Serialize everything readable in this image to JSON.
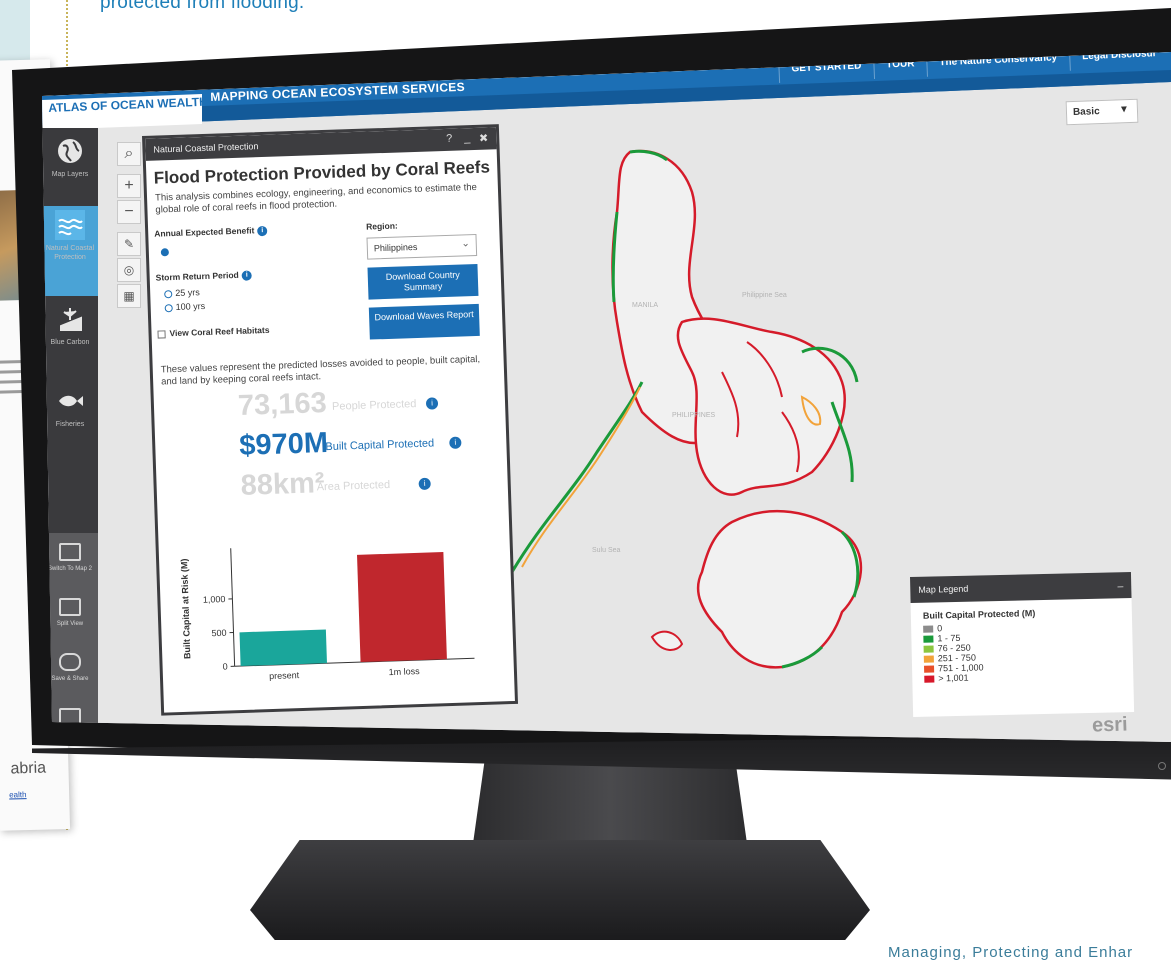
{
  "background": {
    "top_text": "protected from flooding.",
    "side_brand": "abria",
    "side_link": "ealth",
    "footer_text": "Managing, Protecting and Enhar"
  },
  "topnav": {
    "brand": "ATLAS OF OCEAN WEALTH",
    "subtitle": "MAPPING OCEAN ECOSYSTEM SERVICES",
    "links": [
      "GET STARTED",
      "TOUR",
      "The Nature Conservancy",
      "Legal Disclosur"
    ]
  },
  "basemap": {
    "value": "Basic"
  },
  "sidebar": {
    "items": [
      {
        "label": "Map Layers",
        "icon": "globe-icon"
      },
      {
        "label": "Natural Coastal Protection",
        "icon": "waves-icon"
      },
      {
        "label": "Blue Carbon",
        "icon": "mangrove-icon"
      },
      {
        "label": "Fisheries",
        "icon": "fish-icon"
      }
    ],
    "lower_items": [
      {
        "label": "Switch To Map 2",
        "icon": "map-two-icon"
      },
      {
        "label": "Split View",
        "icon": "split-view-icon"
      },
      {
        "label": "Save & Share",
        "icon": "chat-icon"
      }
    ]
  },
  "panel": {
    "header": "Natural Coastal Protection",
    "help": "?",
    "minimize": "_",
    "close": "✖",
    "title": "Flood Protection Provided by Coral Reefs",
    "description": "This analysis combines ecology, engineering, and economics to estimate the global role of coral reefs in flood protection.",
    "annual_label": "Annual Expected Benefit",
    "storm_label": "Storm Return Period",
    "storm_options": [
      "25 yrs",
      "100 yrs"
    ],
    "habitat_checkbox": "View Coral Reef Habitats",
    "region_label": "Region:",
    "region_value": "Philippines",
    "download_country": "Download Country Summary",
    "download_waves": "Download Waves Report",
    "values_desc": "These values represent the predicted losses avoided to people, built capital, and land by keeping coral reefs intact.",
    "stats": [
      {
        "value": "73,163",
        "caption": "People Protected",
        "color": "#d7d7d7"
      },
      {
        "value": "$970M",
        "caption": "Built Capital Protected",
        "color": "#1c6fb5"
      },
      {
        "value": "88km²",
        "caption": "Area Protected",
        "color": "#d7d7d7"
      }
    ]
  },
  "chart_data": {
    "type": "bar",
    "categories": [
      "present",
      "1m loss"
    ],
    "values": [
      500,
      1590
    ],
    "colors": [
      "#1aa69b",
      "#c0272d"
    ],
    "ylabel": "Built Capital at Risk (M)",
    "yticks": [
      0,
      500,
      1000
    ],
    "ytick_labels": [
      "0",
      "500",
      "1,000"
    ],
    "ylim": [
      0,
      1750
    ],
    "grid": false
  },
  "legend": {
    "header": "Map Legend",
    "minimize": "_",
    "title": "Built Capital Protected (M)",
    "entries": [
      {
        "label": "0",
        "color": "#8c8c8c"
      },
      {
        "label": "1 - 75",
        "color": "#1a9a3a"
      },
      {
        "label": "76 - 250",
        "color": "#8cc63f"
      },
      {
        "label": "251 - 750",
        "color": "#f2a33a"
      },
      {
        "label": "751 - 1,000",
        "color": "#e8502a"
      },
      {
        "label": "> 1,001",
        "color": "#d7182a"
      }
    ]
  },
  "map": {
    "labels": [
      "Philippine Sea",
      "PHILIPPINES",
      "Sulu Sea",
      "MANILA"
    ],
    "attribution": "esri"
  }
}
